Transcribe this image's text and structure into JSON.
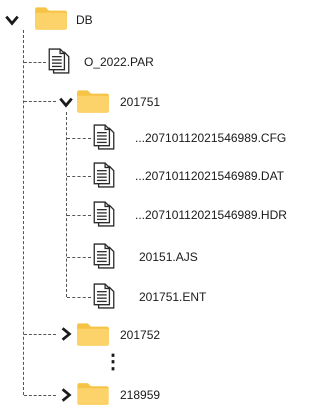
{
  "tree": {
    "root": {
      "label": "DB",
      "icon": "folder-icon",
      "toggle": "chevron-down-icon"
    },
    "items": [
      {
        "label": "O_2022.PAR",
        "icon": "document-icon"
      },
      {
        "label": "201751",
        "icon": "folder-icon",
        "toggle": "chevron-down-icon",
        "children": [
          {
            "label": "...20710112021546989.CFG",
            "icon": "document-icon"
          },
          {
            "label": "...20710112021546989.DAT",
            "icon": "document-icon"
          },
          {
            "label": "...20710112021546989.HDR",
            "icon": "document-icon"
          },
          {
            "label": "20151.AJS",
            "icon": "document-icon"
          },
          {
            "label": "201751.ENT",
            "icon": "document-icon"
          }
        ]
      },
      {
        "label": "201752",
        "icon": "folder-icon",
        "toggle": "chevron-right-icon"
      },
      {
        "label": "218959",
        "icon": "folder-icon",
        "toggle": "chevron-right-icon"
      }
    ],
    "ellipsis": "⋮"
  },
  "colors": {
    "folder": "#FCD36A",
    "folder_tab": "#F6C445",
    "connector": "#555555",
    "doc_stroke": "#2b2b2b"
  }
}
